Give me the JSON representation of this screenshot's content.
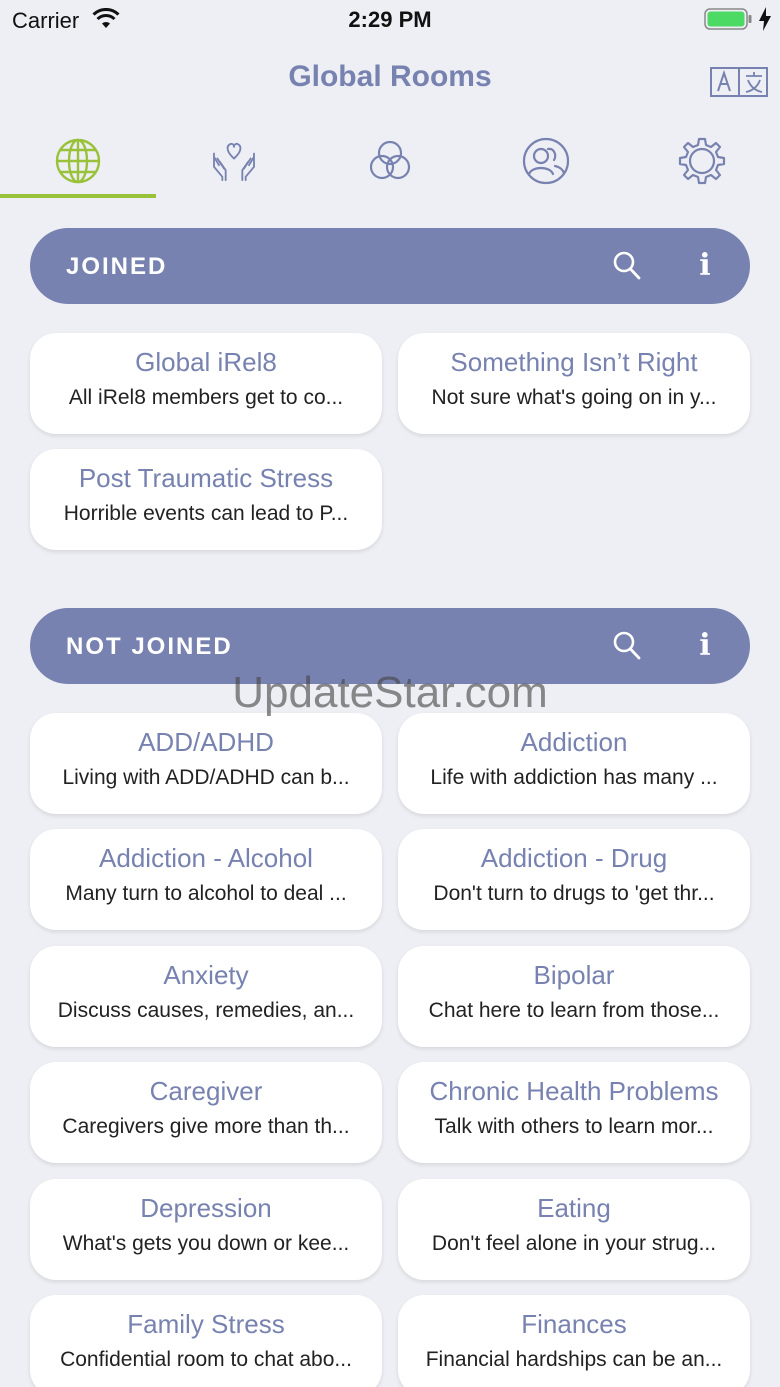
{
  "status_bar": {
    "carrier": "Carrier",
    "time": "2:29 PM"
  },
  "header": {
    "title": "Global Rooms",
    "translate_icon": "translate-icon"
  },
  "tabs": [
    {
      "name": "globe",
      "icon": "globe-icon",
      "active": true
    },
    {
      "name": "support",
      "icon": "hands-heart-icon",
      "active": false
    },
    {
      "name": "circles",
      "icon": "three-circles-icon",
      "active": false
    },
    {
      "name": "people",
      "icon": "people-icon",
      "active": false
    },
    {
      "name": "settings",
      "icon": "gear-icon",
      "active": false
    }
  ],
  "colors": {
    "accent": "#7782b0",
    "tab_active": "#99c23a",
    "background": "#eeeff4"
  },
  "joined": {
    "title": "JOINED",
    "rooms": [
      {
        "title": "Global iRel8",
        "desc": "All iRel8 members get to co..."
      },
      {
        "title": "Something Isn’t Right",
        "desc": "Not sure what's going on in y..."
      },
      {
        "title": "Post Traumatic Stress",
        "desc": "Horrible events can lead to P..."
      }
    ]
  },
  "not_joined": {
    "title": "NOT JOINED",
    "rooms": [
      {
        "title": "ADD/ADHD",
        "desc": "Living with ADD/ADHD can b..."
      },
      {
        "title": "Addiction",
        "desc": "Life with addiction has many ..."
      },
      {
        "title": "Addiction - Alcohol",
        "desc": "Many turn to alcohol to deal ..."
      },
      {
        "title": "Addiction - Drug",
        "desc": "Don't turn to drugs to 'get thr..."
      },
      {
        "title": "Anxiety",
        "desc": "Discuss causes, remedies, an..."
      },
      {
        "title": "Bipolar",
        "desc": "Chat here to learn from those..."
      },
      {
        "title": "Caregiver",
        "desc": "Caregivers give more than th..."
      },
      {
        "title": "Chronic Health Problems",
        "desc": "Talk with others to learn mor..."
      },
      {
        "title": "Depression",
        "desc": "What's gets you down or kee..."
      },
      {
        "title": "Eating",
        "desc": "Don't feel alone in your strug..."
      },
      {
        "title": "Family Stress",
        "desc": "Confidential room to chat abo..."
      },
      {
        "title": "Finances",
        "desc": "Financial hardships can be an..."
      }
    ]
  },
  "watermark": "UpdateStar.com"
}
